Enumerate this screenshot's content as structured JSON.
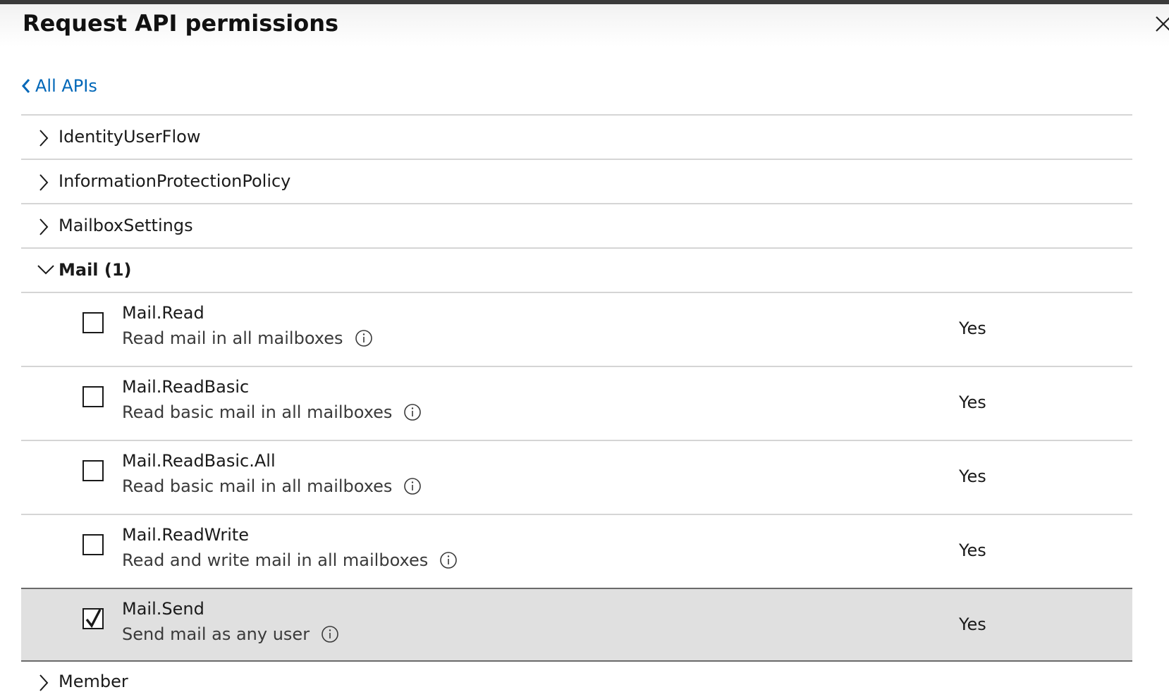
{
  "panel": {
    "title": "Request API permissions"
  },
  "nav": {
    "back_label": "All APIs"
  },
  "groups_before": [
    {
      "label": "IdentityUserFlow"
    },
    {
      "label": "InformationProtectionPolicy"
    },
    {
      "label": "MailboxSettings"
    }
  ],
  "expanded_group": {
    "label": "Mail (1)"
  },
  "permissions": [
    {
      "name": "Mail.Read",
      "description": "Read mail in all mailboxes",
      "admin_consent": "Yes",
      "checked": false
    },
    {
      "name": "Mail.ReadBasic",
      "description": "Read basic mail in all mailboxes",
      "admin_consent": "Yes",
      "checked": false
    },
    {
      "name": "Mail.ReadBasic.All",
      "description": "Read basic mail in all mailboxes",
      "admin_consent": "Yes",
      "checked": false
    },
    {
      "name": "Mail.ReadWrite",
      "description": "Read and write mail in all mailboxes",
      "admin_consent": "Yes",
      "checked": false
    },
    {
      "name": "Mail.Send",
      "description": "Send mail as any user",
      "admin_consent": "Yes",
      "checked": true
    }
  ],
  "groups_after": [
    {
      "label": "Member"
    }
  ],
  "icons": {
    "close": "close-icon",
    "back": "chevron-left-icon",
    "collapsed": "chevron-right-icon",
    "expanded": "chevron-down-icon",
    "info": "info-icon",
    "check": "checkmark-icon"
  },
  "colors": {
    "link": "#0067b8",
    "selected_row": "#e0e0e0",
    "divider": "#d5d5d5"
  }
}
